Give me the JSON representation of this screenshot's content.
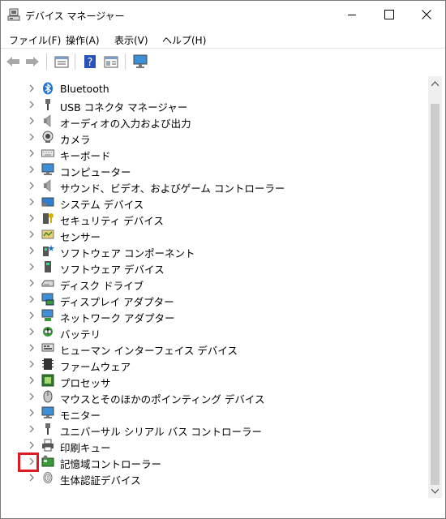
{
  "window": {
    "title": "デバイス マネージャー"
  },
  "menubar": {
    "items": [
      "ファイル(F)",
      "操作(A)",
      "表示(V)",
      "ヘルプ(H)"
    ]
  },
  "toolbar": {
    "buttons": [
      "back-icon",
      "forward-icon",
      "properties-icon",
      "help-icon",
      "view-icon",
      "monitor-scan-icon"
    ]
  },
  "tree": {
    "items": [
      {
        "label": "Bluetooth",
        "icon": "bluetooth-icon"
      },
      {
        "label": "USB コネクタ マネージャー",
        "icon": "usb-icon"
      },
      {
        "label": "オーディオの入力および出力",
        "icon": "speaker-icon"
      },
      {
        "label": "カメラ",
        "icon": "camera-icon"
      },
      {
        "label": "キーボード",
        "icon": "keyboard-icon"
      },
      {
        "label": "コンピューター",
        "icon": "computer-icon"
      },
      {
        "label": "サウンド、ビデオ、およびゲーム コントローラー",
        "icon": "sound-icon"
      },
      {
        "label": "システム デバイス",
        "icon": "system-device-icon"
      },
      {
        "label": "セキュリティ デバイス",
        "icon": "security-device-icon"
      },
      {
        "label": "センサー",
        "icon": "sensor-icon"
      },
      {
        "label": "ソフトウェア コンポーネント",
        "icon": "software-component-icon"
      },
      {
        "label": "ソフトウェア デバイス",
        "icon": "software-device-icon"
      },
      {
        "label": "ディスク ドライブ",
        "icon": "disk-drive-icon"
      },
      {
        "label": "ディスプレイ アダプター",
        "icon": "display-adapter-icon"
      },
      {
        "label": "ネットワーク アダプター",
        "icon": "network-adapter-icon"
      },
      {
        "label": "バッテリ",
        "icon": "battery-icon"
      },
      {
        "label": "ヒューマン インターフェイス デバイス",
        "icon": "hid-icon"
      },
      {
        "label": "ファームウェア",
        "icon": "firmware-icon"
      },
      {
        "label": "プロセッサ",
        "icon": "processor-icon"
      },
      {
        "label": "マウスとそのほかのポインティング デバイス",
        "icon": "mouse-icon"
      },
      {
        "label": "モニター",
        "icon": "monitor-icon"
      },
      {
        "label": "ユニバーサル シリアル バス コントローラー",
        "icon": "usb-controller-icon"
      },
      {
        "label": "印刷キュー",
        "icon": "printer-icon"
      },
      {
        "label": "記憶域コントローラー",
        "icon": "storage-controller-icon"
      },
      {
        "label": "生体認証デバイス",
        "icon": "biometric-icon"
      }
    ]
  },
  "colors": {
    "highlight_border": "#e01a22",
    "accent_blue": "#1e73d2"
  }
}
